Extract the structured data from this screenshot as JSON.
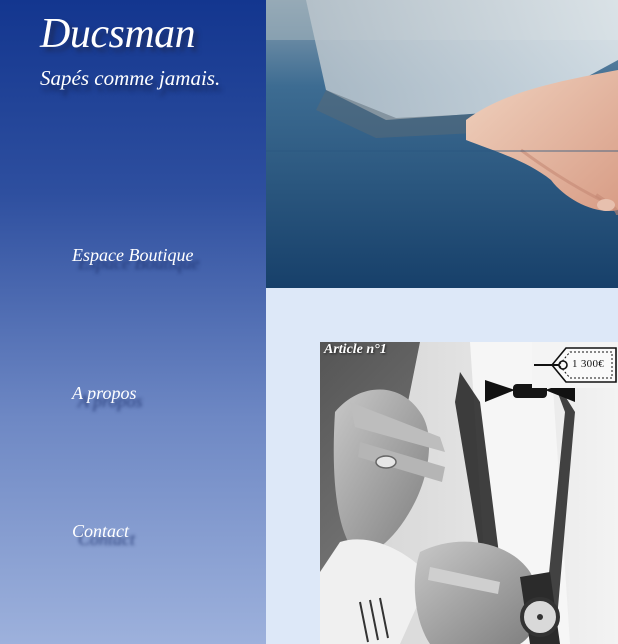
{
  "brand": {
    "name": "Ducsman",
    "tagline": "Sapés comme jamais."
  },
  "nav": {
    "items": [
      {
        "label": "Espace Boutique"
      },
      {
        "label": "A propos"
      },
      {
        "label": "Contact"
      }
    ]
  },
  "article": {
    "title": "Article n°1",
    "price": "1 300€"
  },
  "colors": {
    "sidebar_top": "#13368f",
    "sidebar_bottom": "#9db1dc",
    "content_bg": "#dde8f8"
  },
  "icons": {
    "price_tag": "price-tag-icon"
  }
}
